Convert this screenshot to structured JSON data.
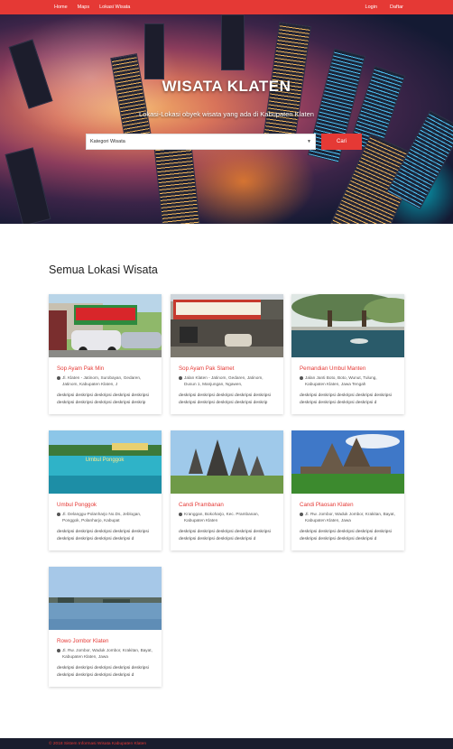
{
  "nav": {
    "items": [
      "Home",
      "Maps",
      "Lokasi Wisata"
    ],
    "login": "Login",
    "register": "Daftar"
  },
  "hero": {
    "title": "WISATA KLATEN",
    "subtitle": "Lokasi-Lokasi obyek wisata yang ada di Kabupaten Klaten",
    "select_value": "Kategori Wisata",
    "search_button": "Cari"
  },
  "section": {
    "title": "Semua Lokasi Wisata"
  },
  "cards": [
    {
      "title": "Sop Ayam Pak Min",
      "address": "Jl. Klaten - Jatinom, Surobayan, Gedaren, Jatinom, Kabupaten Klaten, J",
      "desc": "deskripsi deskripsi deskripsi deskripsi deskripsi deskripsi deskripsi deskripsi deskripsi deskrip"
    },
    {
      "title": "Sop Ayam Pak Slamet",
      "address": "Jalan Klaten - Jatinom, Gedaren, Jatinom, Dusun 1, Manjungan, Ngawen,",
      "desc": "deskripsi deskripsi deskripsi deskripsi deskripsi deskripsi deskripsi deskripsi deskripsi deskrip"
    },
    {
      "title": "Pemandian Umbul Manten",
      "address": "Jalan Janti Boto, Boto, Wunut, Tulung, Kabupaten Klaten, Jawa Tengah",
      "desc": "deskripsi deskripsi deskripsi deskripsi deskripsi deskripsi deskripsi deskripsi deskripsi d"
    },
    {
      "title": "Umbul Ponggok",
      "address": "Jl. Delanggu-Polanharjo No.Ds, Jeblogan, Ponggok, Polanharjo, Kabupat",
      "desc": "deskripsi deskripsi deskripsi deskripsi deskripsi deskripsi deskripsi deskripsi deskripsi d"
    },
    {
      "title": "Candi Prambanan",
      "address": "Kranggan, Bokoharjo, Kec. Prambanan, Kabupaten Klaten",
      "desc": "deskripsi deskripsi deskripsi deskripsi deskripsi deskripsi deskripsi deskripsi deskripsi d"
    },
    {
      "title": "Candi Plaosan Klaten",
      "address": "Jl. Rw. Jombor, Waduk Jombor, Krakitan, Bayat, Kabupaten Klaten, Jawa",
      "desc": "deskripsi deskripsi deskripsi deskripsi deskripsi deskripsi deskripsi deskripsi deskripsi d"
    },
    {
      "title": "Rowo Jombor Klaten",
      "address": "Jl. Rw. Jombor, Waduk Jombor, Krakitan, Bayat, Kabupaten Klaten, Jawa",
      "desc": "deskripsi deskripsi deskripsi deskripsi deskripsi deskripsi deskripsi deskripsi deskripsi d"
    }
  ],
  "footer": {
    "text": "© 2018 Sistem Informasi Wisata Kabupaten Klaten"
  },
  "colors": {
    "accent": "#e53935",
    "footer_bg": "#1a1d2e"
  },
  "icons": {
    "address": "map-pin-icon",
    "select": "chevron-down-icon"
  }
}
